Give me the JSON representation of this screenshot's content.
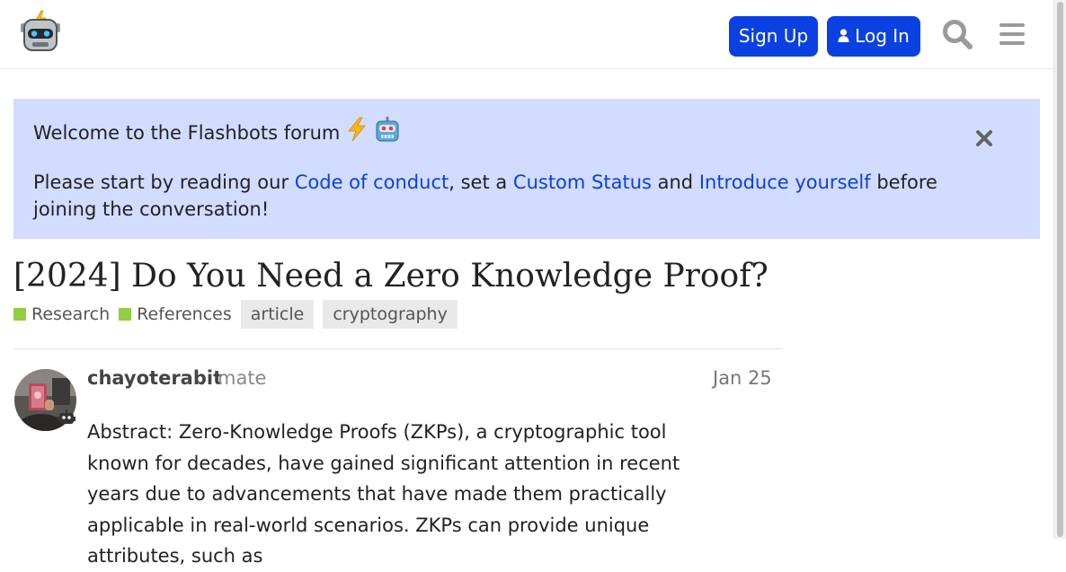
{
  "header": {
    "signup_label": "Sign Up",
    "login_label": "Log In",
    "icons": [
      "robot-logo-icon",
      "user-icon",
      "search-icon",
      "hamburger-menu-icon"
    ]
  },
  "banner": {
    "welcome": "Welcome to the Flashbots forum",
    "intro_prefix": "Please start by reading our ",
    "link_conduct": "Code of conduct",
    "intro_mid1": ", set a ",
    "link_status": "Custom Status",
    "intro_mid2": " and ",
    "link_introduce": "Introduce yourself",
    "intro_suffix": " before joining the conversation!"
  },
  "topic": {
    "title": "[2024] Do You Need a Zero Knowledge Proof?",
    "categories": [
      {
        "label": "Research",
        "color": "#92cd42"
      },
      {
        "label": "References",
        "color": "#92cd42"
      }
    ],
    "tags": [
      "article",
      "cryptography"
    ]
  },
  "post": {
    "username": "chayoterabit",
    "user_title": "mate",
    "date": "Jan 25",
    "body": "Abstract: Zero-Knowledge Proofs (ZKPs), a cryptographic tool known for decades, have gained significant attention in recent years due to advancements that have made them practically applicable in real-world scenarios. ZKPs can provide unique attributes, such as"
  },
  "colors": {
    "accent": "#0b40e3",
    "banner_bg": "#d1dcff",
    "tag_bg": "#e9e9e9"
  }
}
